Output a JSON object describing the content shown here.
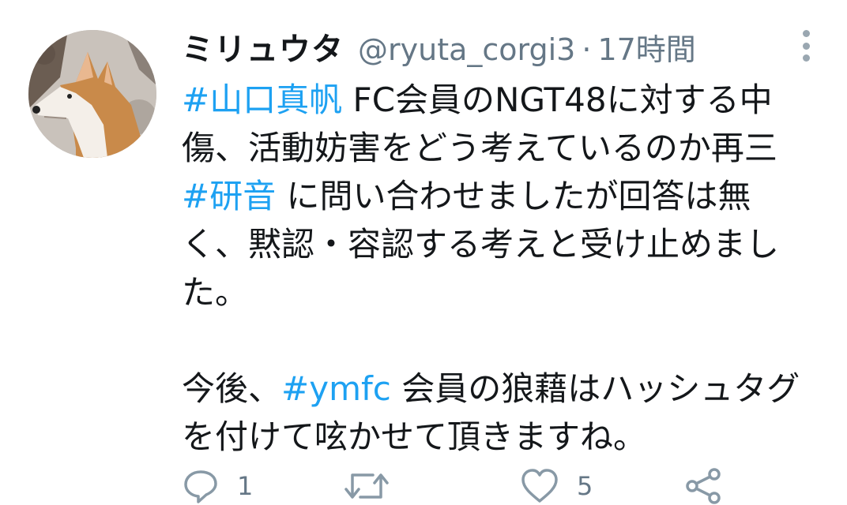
{
  "tweet": {
    "display_name": "ミリュウタ",
    "handle": "@ryuta_corgi3",
    "separator": "·",
    "time": "17時間",
    "lines": [
      [
        {
          "text": "#山口真帆",
          "hashtag": true
        },
        {
          "text": " FC会員のNGT48に対する中",
          "hashtag": false
        }
      ],
      [
        {
          "text": "傷、活動妨害をどう考えているのか再三",
          "hashtag": false
        }
      ],
      [
        {
          "text": "#研音",
          "hashtag": true
        },
        {
          "text": " に問い合わせましたが回答は無",
          "hashtag": false
        }
      ],
      [
        {
          "text": "く、黙認・容認する考えと受け止めまし",
          "hashtag": false
        }
      ],
      [
        {
          "text": "た。",
          "hashtag": false
        }
      ],
      [],
      [
        {
          "text": "今後、",
          "hashtag": false
        },
        {
          "text": "#ymfc",
          "hashtag": true
        },
        {
          "text": " 会員の狼藉はハッシュタグ",
          "hashtag": false
        }
      ],
      [
        {
          "text": "を付けて呟かせて頂きますね。",
          "hashtag": false
        }
      ]
    ]
  },
  "actions": {
    "reply_count": "1",
    "retweet_count": "",
    "like_count": "5"
  },
  "icons": {
    "reply": "reply-icon",
    "retweet": "retweet-icon",
    "like": "like-icon",
    "share": "share-icon",
    "more": "more-vertical-icon",
    "avatar": "corgi-avatar"
  },
  "colors": {
    "hashtag": "#1da1f2",
    "muted": "#657786",
    "text": "#14171a",
    "icon": "#8899a6"
  }
}
